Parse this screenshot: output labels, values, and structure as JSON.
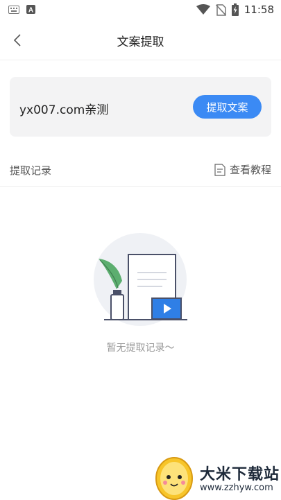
{
  "status_bar": {
    "time": "11:58",
    "icons": [
      "keyboard-icon",
      "a-box-icon",
      "wifi-icon",
      "no-sim-icon",
      "battery-charging-icon"
    ]
  },
  "header": {
    "title": "文案提取",
    "back_icon": "chevron-left-icon"
  },
  "input_card": {
    "value": "yx007.com亲测",
    "button_label": "提取文案"
  },
  "records": {
    "title": "提取记录",
    "tutorial_label": "查看教程",
    "tutorial_icon": "document-icon"
  },
  "empty_state": {
    "message": "暂无提取记录～"
  },
  "watermark": {
    "title": "大米下载站",
    "url": "www.zzhyw.com"
  },
  "colors": {
    "accent": "#3b8af4",
    "card_bg": "#f3f3f4",
    "divider": "#eeeeee"
  }
}
